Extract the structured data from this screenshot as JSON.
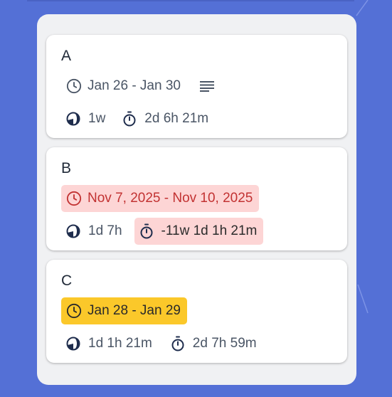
{
  "cards": [
    {
      "title": "A",
      "date_range": "Jan 26 - Jan 30",
      "date_icon": "clock-icon",
      "has_notes": true,
      "notes_icon": "notes-icon",
      "estimate": "1w",
      "estimate_icon": "moon-icon",
      "time_spent": "2d 6h 21m",
      "time_icon": "stopwatch-icon",
      "date_status": "normal",
      "time_status": "normal"
    },
    {
      "title": "B",
      "date_range": "Nov 7, 2025 - Nov 10, 2025",
      "date_icon": "clock-icon",
      "estimate": "1d 7h",
      "estimate_icon": "moon-icon",
      "time_spent": "-11w 1d 1h 21m",
      "time_icon": "stopwatch-icon",
      "date_status": "overdue",
      "time_status": "overdue"
    },
    {
      "title": "C",
      "date_range": "Jan 28 - Jan 29",
      "date_icon": "clock-icon",
      "estimate": "1d 1h 21m",
      "estimate_icon": "moon-icon",
      "time_spent": "2d 7h 59m",
      "time_icon": "stopwatch-icon",
      "date_status": "due-soon",
      "time_status": "normal"
    }
  ],
  "colors": {
    "background": "#5470d6",
    "panel": "#f0f1f3",
    "card": "#ffffff",
    "overdue_bg": "#fdd5d5",
    "overdue_text": "#c23232",
    "due_soon_bg": "#fbc82a",
    "text": "#4a5565",
    "icon_dark": "#1f2d4d"
  }
}
